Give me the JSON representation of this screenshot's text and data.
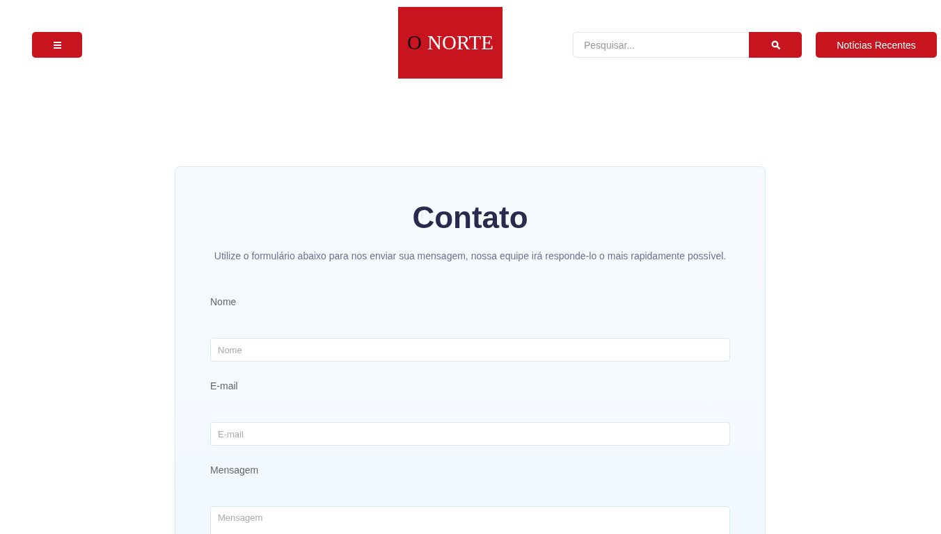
{
  "header": {
    "logo": {
      "first": "O",
      "rest": "NORTE"
    },
    "search": {
      "placeholder": "Pesquisar..."
    },
    "recent_button": "Notícias Recentes"
  },
  "contact": {
    "title": "Contato",
    "intro": "Utilize o formulário abaixo para nos enviar sua mensagem, nossa equipe irá responde-lo o mais rapidamente possível.",
    "fields": [
      {
        "kind": "input",
        "label": "Nome",
        "placeholder": "Nome"
      },
      {
        "kind": "input",
        "label": "E-mail",
        "placeholder": "E-mail"
      },
      {
        "kind": "textarea",
        "label": "Mensagem",
        "placeholder": "Mensagem"
      }
    ]
  }
}
